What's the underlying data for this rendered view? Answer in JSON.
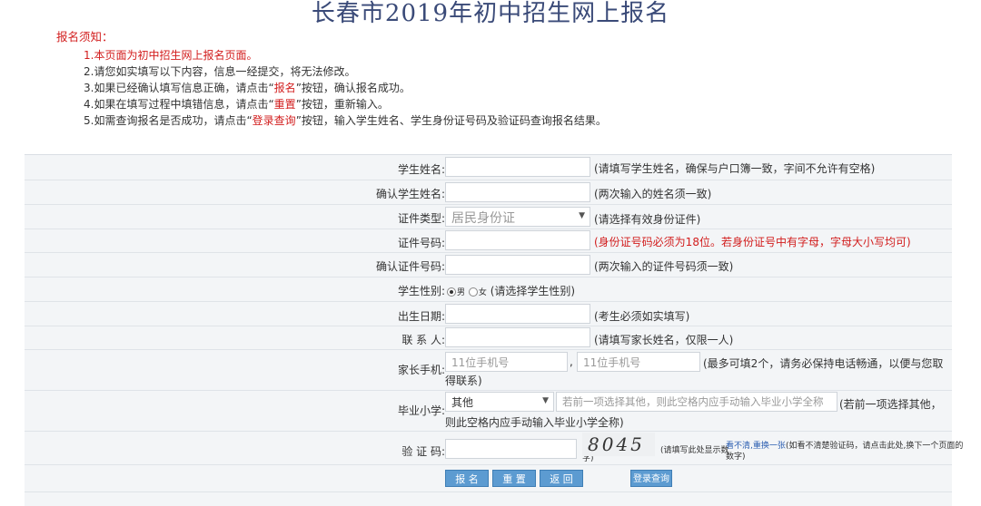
{
  "page": {
    "title": "长春市2019年初中招生网上报名"
  },
  "notice": {
    "title": "报名须知：",
    "line1": "1.本页面为初中招生网上报名页面。",
    "line2": "2.请您如实填写以下内容，信息一经提交，将无法修改。",
    "line3_a": "3.如果已经确认填写信息正确，请点击“",
    "line3_hl": "报名",
    "line3_b": "”按钮，确认报名成功。",
    "line4_a": "4.如果在填写过程中填错信息，请点击“",
    "line4_hl": "重置",
    "line4_b": "”按钮，重新输入。",
    "line5_a": "5.如需查询报名是否成功，请点击“",
    "line5_hl": "登录查询",
    "line5_b": "”按钮，输入学生姓名、学生身份证号码及验证码查询报名结果。"
  },
  "form": {
    "student_name": {
      "label": "学生姓名:",
      "value": "",
      "hint": "(请填写学生姓名，确保与户口簿一致，字间不允许有空格)"
    },
    "confirm_name": {
      "label": "确认学生姓名:",
      "value": "",
      "hint": "(两次输入的姓名须一致)"
    },
    "id_type": {
      "label": "证件类型:",
      "selected": "居民身份证",
      "hint": "(请选择有效身份证件)"
    },
    "id_number": {
      "label": "证件号码:",
      "value": "",
      "hint": "(身份证号码必须为18位。若身份证号中有字母，字母大小写均可)"
    },
    "confirm_id": {
      "label": "确认证件号码:",
      "value": "",
      "hint": "(两次输入的证件号码须一致)"
    },
    "gender": {
      "label": "学生性别:",
      "male": "男",
      "female": "女",
      "selected": "男",
      "hint": "(请选择学生性别)"
    },
    "birth": {
      "label": "出生日期:",
      "value": "",
      "hint": "(考生必须如实填写)"
    },
    "contact": {
      "label": "联 系 人:",
      "value": "",
      "hint": "(请填写家长姓名，仅限一人)"
    },
    "phone": {
      "label": "家长手机:",
      "placeholder1": "11位手机号",
      "sep": ",",
      "placeholder2": "11位手机号",
      "hint1": "(最多可填2个，请务必保持电话畅通，以便与您取",
      "hint2": "得联系)"
    },
    "school": {
      "label": "毕业小学:",
      "selected": "其他",
      "placeholder": "若前一项选择其他，则此空格内应手动输入毕业小学全称",
      "hint1": "(若前一项选择其他，",
      "hint2": "则此空格内应手动输入毕业小学全称)"
    },
    "captcha": {
      "label": "验 证 码:",
      "value": "",
      "code": "8045",
      "note1": "(请填写此处显示数",
      "note2": "字)",
      "refresh": "看不清,重换一张",
      "note3": "(如看不清楚验证码，请点击此处,换下一个页面的",
      "note4": "数字)"
    }
  },
  "buttons": {
    "submit": "报 名",
    "reset": "重 置",
    "back": "返 回",
    "query": "登录查询"
  }
}
